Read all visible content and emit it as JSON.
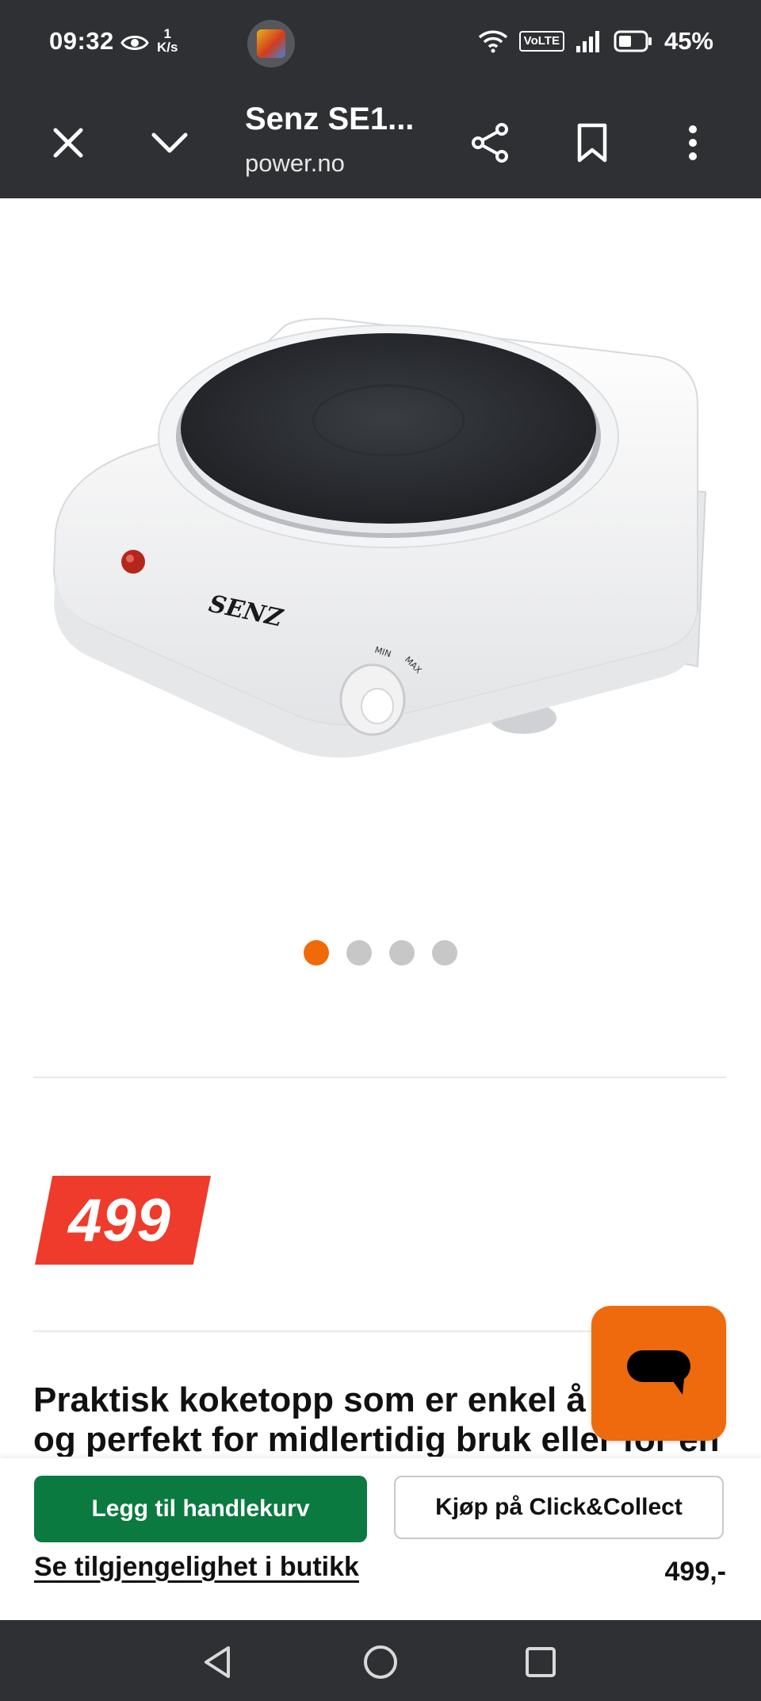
{
  "status_bar": {
    "time": "09:32",
    "speed_value": "1",
    "speed_unit": "K/s",
    "volte": "VoLTE",
    "battery": "45%",
    "icons": [
      "eye-icon",
      "wifi-icon",
      "signal-icon",
      "battery-icon"
    ]
  },
  "header": {
    "title": "Senz SE1...",
    "url": "power.no",
    "icons": [
      "close-icon",
      "chevron-down-icon",
      "share-icon",
      "bookmark-icon",
      "more-vert-icon"
    ]
  },
  "product": {
    "brand_on_image": "SENZ",
    "knob_min": "MIN",
    "knob_max": "MAX",
    "gallery_total": 4,
    "gallery_active_index": 1,
    "price": "499",
    "description": "Praktisk koketopp som er enkel å t... og perfekt for midlertidig bruk eller for en"
  },
  "description_lines": [
    "Praktisk koketopp som er enkel å t",
    "og perfekt for midlertidig bruk eller for en"
  ],
  "actions": {
    "add_to_cart": "Legg til handlekurv",
    "click_collect": "Kjøp på Click&Collect",
    "availability_link": "Se tilgjengelighet i butikk",
    "price_text": "499,-"
  },
  "colors": {
    "bars": "#2f3033",
    "accent_orange": "#f06a0a",
    "price_red": "#ee3b2b",
    "cart_green": "#0b7a40"
  }
}
